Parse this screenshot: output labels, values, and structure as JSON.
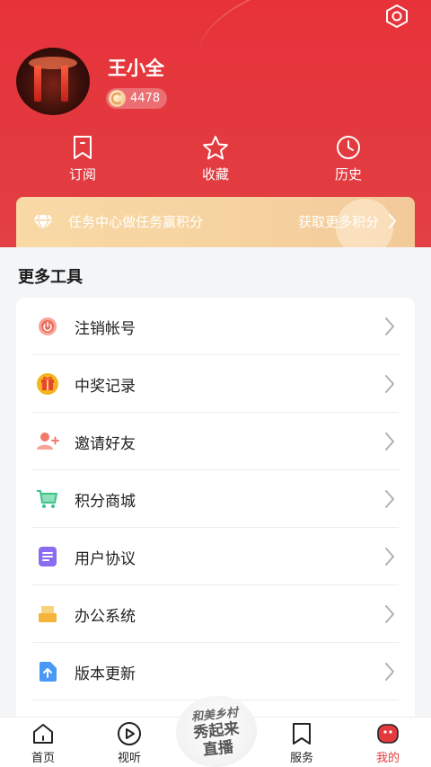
{
  "profile": {
    "name": "王小全",
    "points": "4478"
  },
  "quick_actions": [
    {
      "label": "订阅",
      "icon": "bookmark-icon"
    },
    {
      "label": "收藏",
      "icon": "star-icon"
    },
    {
      "label": "历史",
      "icon": "clock-icon"
    }
  ],
  "task_banner": {
    "title": "任务中心做任务赢积分",
    "action": "获取更多积分"
  },
  "tools": {
    "section_title": "更多工具",
    "items": [
      {
        "label": "注销帐号",
        "icon": "power-icon",
        "color": "#f06a5a"
      },
      {
        "label": "中奖记录",
        "icon": "gift-icon",
        "color": "#f5b51f"
      },
      {
        "label": "邀请好友",
        "icon": "add-user-icon",
        "color": "#f07a6a"
      },
      {
        "label": "积分商城",
        "icon": "cart-icon",
        "color": "#3cc38a"
      },
      {
        "label": "用户协议",
        "icon": "document-icon",
        "color": "#8a6cf0"
      },
      {
        "label": "办公系统",
        "icon": "folder-icon",
        "color": "#f5b43a"
      },
      {
        "label": "版本更新",
        "icon": "upload-icon",
        "color": "#4a9af5"
      }
    ]
  },
  "tabbar": {
    "items": [
      {
        "label": "首页",
        "icon": "home-icon"
      },
      {
        "label": "视听",
        "icon": "play-icon"
      },
      {
        "label": "服务",
        "icon": "bookmark-icon"
      },
      {
        "label": "我的",
        "icon": "profile-icon"
      }
    ],
    "active_color": "#e23a3f",
    "center_badge": {
      "line1": "和美乡村",
      "line2": "秀起来",
      "line3": "直播"
    }
  },
  "colors": {
    "brand": "#e23a3f",
    "banner": "#f6d3a0"
  }
}
